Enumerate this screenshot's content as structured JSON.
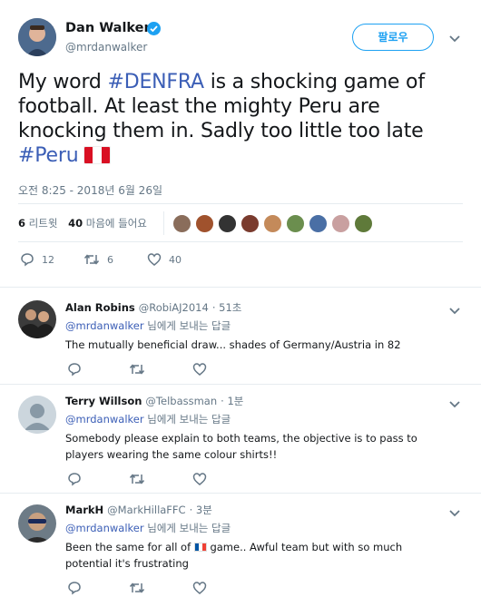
{
  "tweet": {
    "author_name": "Dan Walker",
    "author_handle": "@mrdanwalker",
    "follow_label": "팔로우",
    "text_part1": "My word ",
    "hashtag1": "#DENFRA",
    "text_part2": " is a shocking game of football. At least the mighty Peru are knocking them in. Sadly too little too late ",
    "hashtag2": "#Peru",
    "timestamp": "오전 8:25 - 2018년 6월 26일",
    "retweet_count": "6",
    "retweet_label": "리트윗",
    "like_count": "40",
    "like_label": "마음에 들어요",
    "actions": {
      "reply_count": "12",
      "retweet_count": "6",
      "like_count": "40"
    }
  },
  "replies": [
    {
      "name": "Alan Robins",
      "handle": "@RobiAJ2014",
      "time": "· 51초",
      "to_mention": "@mrdanwalker",
      "to_suffix": " 님에게 보내는 답글",
      "text": "The mutually beneficial draw... shades of Germany/Austria in 82"
    },
    {
      "name": "Terry Willson",
      "handle": "@Telbassman",
      "time": "· 1분",
      "to_mention": "@mrdanwalker",
      "to_suffix": " 님에게 보내는 답글",
      "text": "Somebody please explain to both teams, the objective is to pass to players wearing the same colour shirts!!"
    },
    {
      "name": "MarkH",
      "handle": "@MarkHillaFFC",
      "time": "· 3분",
      "to_mention": "@mrdanwalker",
      "to_suffix": " 님에게 보내는 답글",
      "text_part1": "Been the same for all of ",
      "text_part2": " game.. Awful team but with so much potential it's frustrating"
    }
  ],
  "icons": {
    "verified": "verified-badge-icon",
    "chevron": "chevron-down-icon",
    "reply": "reply-icon",
    "retweet": "retweet-icon",
    "like": "heart-icon",
    "flag_peru": "peru-flag-icon",
    "flag_france": "france-flag-icon"
  },
  "colors": {
    "accent": "#1da1f2",
    "hashtag": "#3b5eb6",
    "muted": "#657786",
    "text": "#14171a"
  }
}
